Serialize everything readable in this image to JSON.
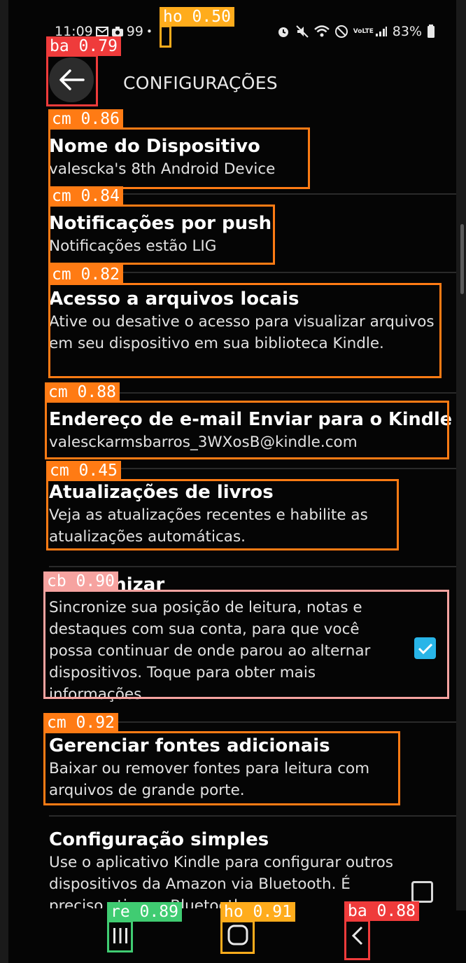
{
  "status_bar": {
    "time": "11:09",
    "left_icons": [
      "mail-icon",
      "camera-icon"
    ],
    "notification_count": "99",
    "battery": "83%",
    "right_icons": [
      "alarm-icon",
      "mute-icon",
      "wifi-icon",
      "do-not-disturb-icon",
      "volte-icon",
      "signal-icon",
      "battery-icon"
    ],
    "volte_label": "VoLTE"
  },
  "header": {
    "title": "CONFIGURAÇÕES",
    "back_icon": "arrow-left-icon"
  },
  "settings": [
    {
      "title": "Nome do Dispositivo",
      "subtitle": "valescka's 8th Android Device"
    },
    {
      "title": "Notificações por push",
      "subtitle": "Notificações estão LIG"
    },
    {
      "title": "Acesso a arquivos locais",
      "subtitle": "Ative ou desative o acesso para visualizar arquivos em seu dispositivo em sua biblioteca Kindle."
    },
    {
      "title": "Endereço de e-mail Enviar para o Kindle",
      "subtitle": "valesckarmsbarros_3WXosB@kindle.com"
    },
    {
      "title": "Atualizações de livros",
      "subtitle": "Veja as atualizações recentes e habilite as atualizações automáticas."
    },
    {
      "title": "Sincronizar",
      "subtitle": "Sincronize sua posição de leitura, notas e destaques com sua conta, para que você possa continuar de onde parou ao alternar dispositivos. Toque para obter mais informações.",
      "checked": true
    },
    {
      "title": "Gerenciar fontes adicionais",
      "subtitle": "Baixar ou remover fontes para leitura com arquivos de grande porte."
    },
    {
      "title": "Configuração simples",
      "subtitle": "Use o aplicativo Kindle para configurar outros dispositivos da Amazon via Bluetooth. É preciso ativar o Bluetooth.",
      "checked": false
    }
  ],
  "detections": [
    {
      "label": "ho 0.50"
    },
    {
      "label": "ba 0.79"
    },
    {
      "label": "cm 0.86"
    },
    {
      "label": "cm 0.84"
    },
    {
      "label": "cm 0.82"
    },
    {
      "label": "cm 0.88"
    },
    {
      "label": "cm 0.45"
    },
    {
      "label": "cb 0.90"
    },
    {
      "label": "cm 0.92"
    },
    {
      "label": "re 0.89"
    },
    {
      "label": "ho 0.91"
    },
    {
      "label": "ba 0.88"
    }
  ],
  "nav_bar": {
    "recents_icon": "recents-icon",
    "home_icon": "home-icon",
    "back_icon": "back-chevron-icon"
  },
  "colors": {
    "background": "#050505",
    "checkbox_accent": "#28b5e8",
    "det_orange": "#ff7b14",
    "det_red": "#ef3b3b",
    "det_yellow": "#ffac1c",
    "det_pink": "#f6a3a0",
    "det_green": "#40cc72"
  }
}
